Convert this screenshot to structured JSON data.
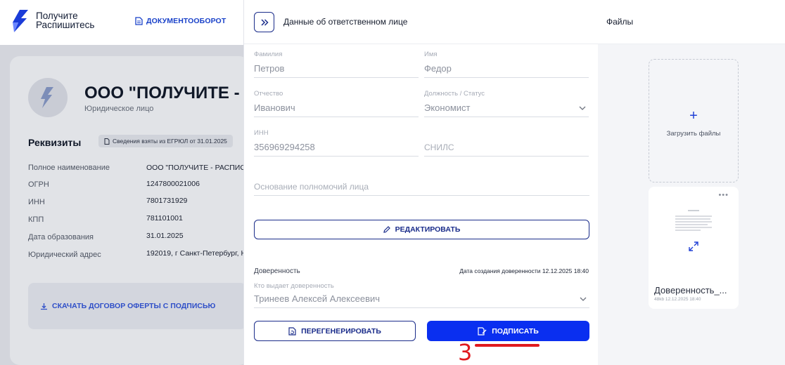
{
  "header": {
    "logo_line1": "Получите",
    "logo_line2": "Распишитесь",
    "nav_link": "ДОКУМЕНТООБОРОТ"
  },
  "company": {
    "name": "ООО \"ПОЛУЧИТЕ -",
    "type": "Юридическое лицо",
    "requisites_title": "Реквизиты",
    "egrul_badge": "Сведения взяты из ЕГРЮЛ от 31.01.2025",
    "rows": [
      {
        "label": "Полное наименование",
        "value": "ООО \"ПОЛУЧИТЕ - РАСПИСЦ"
      },
      {
        "label": "ОГРН",
        "value": "1247800021006"
      },
      {
        "label": "ИНН",
        "value": "7801731929"
      },
      {
        "label": "КПП",
        "value": "781101001"
      },
      {
        "label": "Дата образования",
        "value": "31.01.2025"
      },
      {
        "label": "Юридический адрес",
        "value": "192019, г Санкт-Петербург, Н"
      }
    ],
    "offer_link": "СКАЧАТЬ ДОГОВОР ОФЕРТЫ С ПОДПИСЬЮ"
  },
  "panel": {
    "title": "Данные об ответственном лице",
    "fields": {
      "surname": {
        "label": "Фамилия",
        "value": "Петров"
      },
      "name": {
        "label": "Имя",
        "value": "Федор"
      },
      "patronymic": {
        "label": "Отчество",
        "value": "Иванович"
      },
      "position": {
        "label": "Должность / Статус",
        "value": "Экономист"
      },
      "inn": {
        "label": "ИНН",
        "value": "356969294258"
      },
      "snils": {
        "placeholder": "СНИЛС"
      },
      "authority": {
        "placeholder": "Основание полномочий лица"
      }
    },
    "edit_button": "РЕДАКТИРОВАТЬ",
    "poa_label": "Доверенность",
    "poa_created": "Дата создания доверенности 12.12.2025 18:40",
    "issuer_label": "Кто выдает доверенность",
    "issuer_value": "Тринеев Алексей Алексеевич",
    "regenerate_button": "ПЕРЕГЕНЕРИРОВАТЬ",
    "sign_button": "ПОДПИСАТЬ"
  },
  "annotation": {
    "number": "3",
    "color": "#e0191e"
  },
  "files": {
    "title": "Файлы",
    "upload_plus": "+",
    "upload_label": "Загрузить файлы",
    "file_menu": "•••",
    "file_name": "Доверенность_...",
    "file_meta": "48kb 12.12.2025 18:40"
  },
  "colors": {
    "accent": "#0a2ff0",
    "outline": "#1a2c8a",
    "link": "#1941c9"
  }
}
